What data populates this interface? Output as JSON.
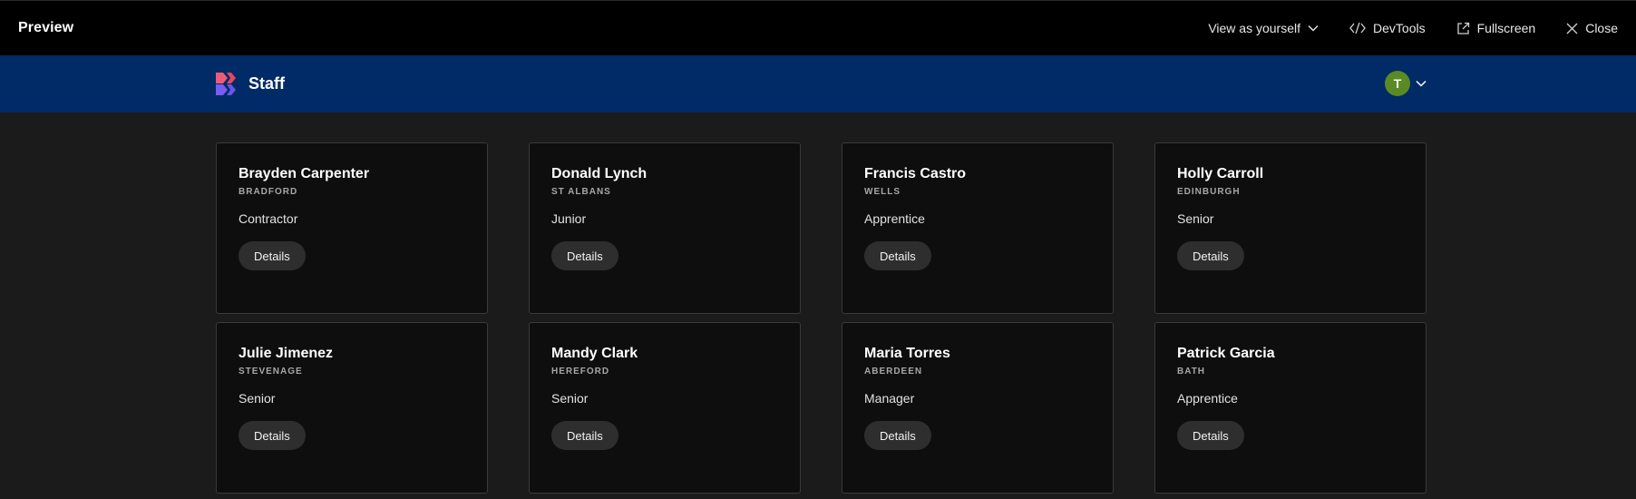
{
  "preview_bar": {
    "title": "Preview",
    "view_as_label": "View as yourself",
    "devtools_label": "DevTools",
    "fullscreen_label": "Fullscreen",
    "close_label": "Close"
  },
  "header": {
    "app_name": "Staff",
    "avatar_initial": "T",
    "colors": {
      "bar": "#002b66",
      "avatar": "#5a8a24"
    }
  },
  "staff": [
    {
      "name": "Brayden Carpenter",
      "city": "BRADFORD",
      "role": "Contractor",
      "button": "Details"
    },
    {
      "name": "Donald Lynch",
      "city": "ST ALBANS",
      "role": "Junior",
      "button": "Details"
    },
    {
      "name": "Francis Castro",
      "city": "WELLS",
      "role": "Apprentice",
      "button": "Details"
    },
    {
      "name": "Holly Carroll",
      "city": "EDINBURGH",
      "role": "Senior",
      "button": "Details"
    },
    {
      "name": "Julie Jimenez",
      "city": "STEVENAGE",
      "role": "Senior",
      "button": "Details"
    },
    {
      "name": "Mandy Clark",
      "city": "HEREFORD",
      "role": "Senior",
      "button": "Details"
    },
    {
      "name": "Maria Torres",
      "city": "ABERDEEN",
      "role": "Manager",
      "button": "Details"
    },
    {
      "name": "Patrick Garcia",
      "city": "BATH",
      "role": "Apprentice",
      "button": "Details"
    }
  ]
}
